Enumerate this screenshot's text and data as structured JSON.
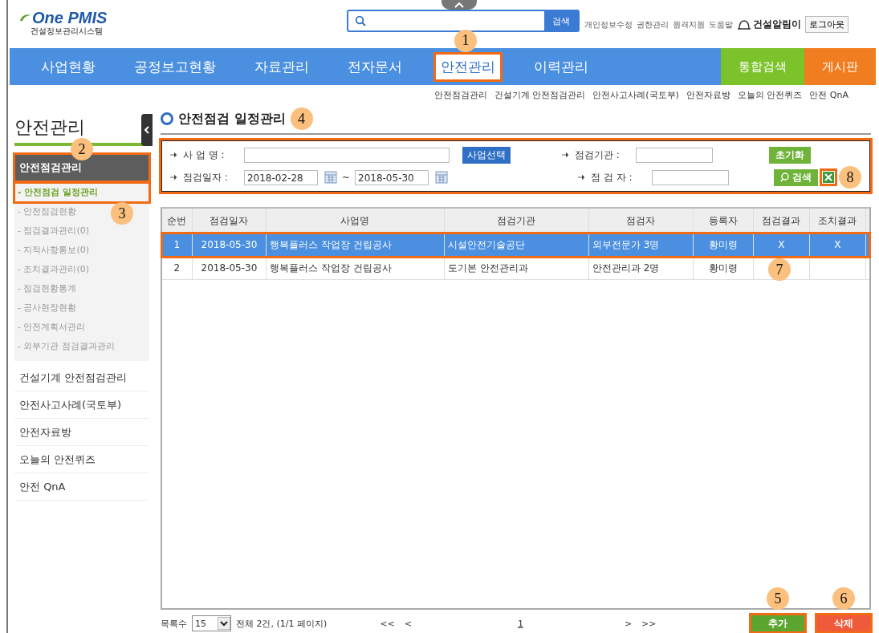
{
  "header": {
    "logo": {
      "brand": "One PMIS",
      "subtitle": "건설정보관리시스템"
    },
    "search": {
      "button": "검색"
    },
    "links": [
      "개인정보수정",
      "권한관리",
      "원격지원",
      "도움말"
    ],
    "alert_brand": "건설알림이",
    "logout": "로그아웃"
  },
  "nav": {
    "items": [
      {
        "label": "사업현황",
        "selected": false,
        "highlighted": false
      },
      {
        "label": "공정보고현황",
        "selected": false,
        "highlighted": false
      },
      {
        "label": "자료관리",
        "selected": false,
        "highlighted": false
      },
      {
        "label": "전자문서",
        "selected": false,
        "highlighted": false
      },
      {
        "label": "안전관리",
        "selected": true,
        "highlighted": true,
        "callout": "1"
      },
      {
        "label": "이력관리",
        "selected": false,
        "highlighted": false
      }
    ],
    "extra": [
      {
        "label": "통합검색",
        "kind": "search"
      },
      {
        "label": "게시판",
        "kind": "board"
      }
    ]
  },
  "sub_links": [
    "안전점검관리",
    "건설기계 안전점검관리",
    "안전사고사례(국토부)",
    "안전자료방",
    "오늘의 안전퀴즈",
    "안전 QnA"
  ],
  "sidebar": {
    "title": "안전관리",
    "callout": "2",
    "groups": [
      {
        "label": "안전점검관리",
        "selected": true,
        "highlighted": true,
        "children": [
          {
            "label": "- 안전점검 일정관리",
            "selected": true,
            "highlighted": true,
            "callout": "3"
          },
          {
            "label": "- 안전점검현황",
            "selected": false,
            "highlighted": false
          },
          {
            "label": "- 점검결과관리(0)",
            "selected": false,
            "highlighted": false
          },
          {
            "label": "- 지적사항통보(0)",
            "selected": false,
            "highlighted": false
          },
          {
            "label": "- 조치결과관리(0)",
            "selected": false,
            "highlighted": false
          },
          {
            "label": "- 점검현황통계",
            "selected": false,
            "highlighted": false
          },
          {
            "label": "- 공사현장현황",
            "selected": false,
            "highlighted": false
          },
          {
            "label": "- 안전계획서관리",
            "selected": false,
            "highlighted": false
          },
          {
            "label": "- 외부기관 점검결과관리",
            "selected": false,
            "highlighted": false
          }
        ]
      },
      {
        "label": "건설기계 안전점검관리",
        "selected": false,
        "highlighted": false
      },
      {
        "label": "안전사고사례(국토부)",
        "selected": false,
        "highlighted": false
      },
      {
        "label": "안전자료방",
        "selected": false,
        "highlighted": false
      },
      {
        "label": "오늘의 안전퀴즈",
        "selected": false,
        "highlighted": false
      },
      {
        "label": "안전 QnA",
        "selected": false,
        "highlighted": false
      }
    ]
  },
  "main": {
    "title": "안전점검 일정관리",
    "callout": "4",
    "filter": {
      "highlighted": true,
      "project_label": "사 업 명 :",
      "project_button": "사업선택",
      "agency_label": "점검기관 :",
      "date_label": "점검일자 :",
      "date_from": "2018-02-28",
      "date_sep": "~",
      "date_to": "2018-05-30",
      "inspector_label": "점 검 자 :",
      "reset_button": "초기화",
      "search_button": "검색",
      "excel": {
        "highlighted": true,
        "callout": "8"
      }
    },
    "table": {
      "callout": "7",
      "columns": [
        "순번",
        "점검일자",
        "사업명",
        "점검기관",
        "점검자",
        "등록자",
        "점검결과",
        "조치결과"
      ],
      "rows": [
        {
          "selected": true,
          "highlighted": true,
          "cells": [
            "1",
            "2018-05-30",
            "행복플러스 작업장 건립공사",
            "시설안전기술공단",
            "외부전문가 3명",
            "황미령",
            "X",
            "X"
          ]
        },
        {
          "selected": false,
          "highlighted": false,
          "cells": [
            "2",
            "2018-05-30",
            "행복플러스 작업장 건립공사",
            "도기본 안전관리과",
            "안전관리과 2명",
            "황미령"
          ]
        }
      ]
    },
    "footer": {
      "page_size_label": "목록수",
      "page_size": "15",
      "total": "전체 2건, (1/1 페이지)",
      "first": "<<",
      "prev": "<",
      "page": "1",
      "next": ">",
      "last": ">>",
      "buttons": [
        {
          "label": "추가",
          "kind": "add",
          "highlighted": true,
          "callout": "5"
        },
        {
          "label": "삭제",
          "kind": "delete",
          "highlighted": true,
          "callout": "6"
        }
      ]
    }
  }
}
